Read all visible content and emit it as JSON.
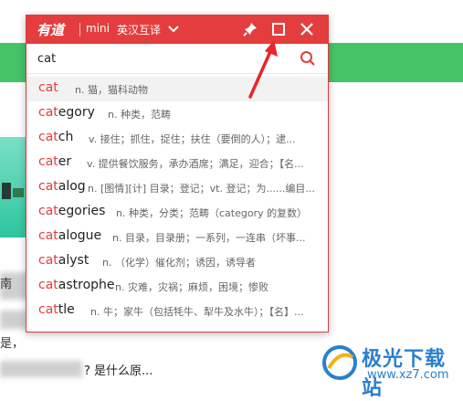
{
  "popup": {
    "logo": "有道",
    "mini_label": "mini",
    "mode_label": "英汉互译",
    "search_value": "cat"
  },
  "results": [
    {
      "prefix": "cat",
      "rest": "",
      "def": "n. 猫，猫科动物"
    },
    {
      "prefix": "cat",
      "rest": "egory",
      "def": "n. 种类，范畴"
    },
    {
      "prefix": "cat",
      "rest": "ch",
      "def": "v. 接住；抓住，捉住；扶住（要倒的人）；逮..."
    },
    {
      "prefix": "cat",
      "rest": "er",
      "def": "v. 提供餐饮服务，承办酒席；满足，迎合；【名..."
    },
    {
      "prefix": "cat",
      "rest": "alog",
      "def": "n. [图情][计] 目录；登记；vt. 登记；为......编目..."
    },
    {
      "prefix": "cat",
      "rest": "egories",
      "def": "n. 种类，分类；范畴（category 的复数）"
    },
    {
      "prefix": "cat",
      "rest": "alogue",
      "def": "n. 目录，目录册；一系列，一连串（坏事..."
    },
    {
      "prefix": "cat",
      "rest": "alyst",
      "def": "n. （化学）催化剂；诱因，诱导者"
    },
    {
      "prefix": "cat",
      "rest": "astrophe",
      "def": "n. 灾难，灾祸；麻烦，困境；惨败"
    },
    {
      "prefix": "cat",
      "rest": "tle",
      "def": "n. 牛；家牛（包括牦牛、犁牛及水牛）；【名】..."
    }
  ],
  "background": {
    "left_text_1": "南",
    "left_text_2": "是，",
    "question": "? 是什么原..."
  },
  "watermark": {
    "title": "极光下载站",
    "url": "www.xz7.com"
  },
  "colors": {
    "brand_red": "#e43d3d",
    "page_green": "#45c367",
    "watermark_blue": "#2a7fd0"
  },
  "icons": [
    "chevron-down-icon",
    "pin-icon",
    "maximize-icon",
    "close-icon",
    "search-icon",
    "arrow-annotation"
  ]
}
